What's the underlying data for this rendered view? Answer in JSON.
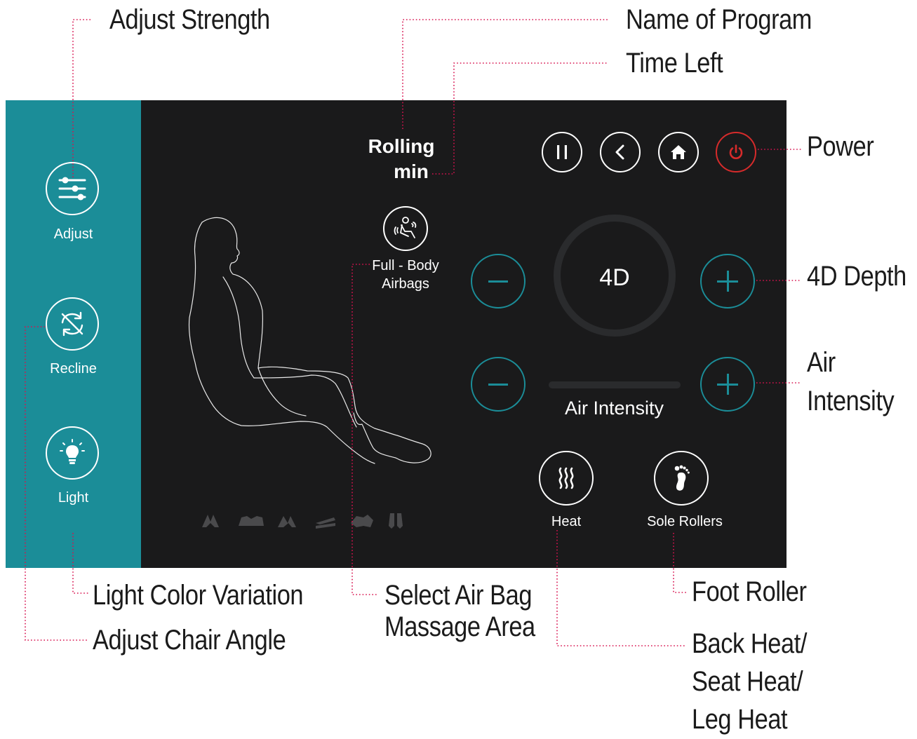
{
  "callouts": {
    "adjust_strength": "Adjust Strength",
    "name_of_program": "Name of Program",
    "time_left": "Time Left",
    "power": "Power",
    "depth_4d": "4D Depth",
    "air_intensity_1": "Air",
    "air_intensity_2": "Intensity",
    "light_color": "Light Color Variation",
    "chair_angle": "Adjust Chair Angle",
    "air_bag_1": "Select Air Bag",
    "air_bag_2": "Massage Area",
    "foot_roller": "Foot Roller",
    "heat_1": "Back Heat/",
    "heat_2": "Seat Heat/",
    "heat_3": "Leg Heat"
  },
  "sidebar": {
    "items": [
      {
        "label": "Adjust",
        "icon": "sliders-icon"
      },
      {
        "label": "Recline",
        "icon": "recline-arrows-icon"
      },
      {
        "label": "Light",
        "icon": "lightbulb-icon"
      }
    ]
  },
  "program": {
    "name": "Rolling",
    "time": "min"
  },
  "airbags": {
    "label_1": "Full - Body",
    "label_2": "Airbags",
    "icon": "airbag-body-icon"
  },
  "top_buttons": [
    "pause-icon",
    "back-chevron-icon",
    "home-icon",
    "power-icon"
  ],
  "depth": {
    "label": "4D",
    "level": 0
  },
  "air_intensity": {
    "label": "Air Intensity",
    "level": 0
  },
  "heat": {
    "label": "Heat",
    "icon": "heat-waves-icon"
  },
  "sole": {
    "label": "Sole Rollers",
    "icon": "foot-icon"
  },
  "massage_area_icons": [
    "arms-icon",
    "shoulders-icon",
    "back-icon",
    "seat-icon",
    "legs-icon",
    "feet-icon"
  ],
  "colors": {
    "accent": "#1b8d98",
    "panel": "#1a1a1b",
    "power": "#d62b2b",
    "leader": "#d8124f"
  }
}
